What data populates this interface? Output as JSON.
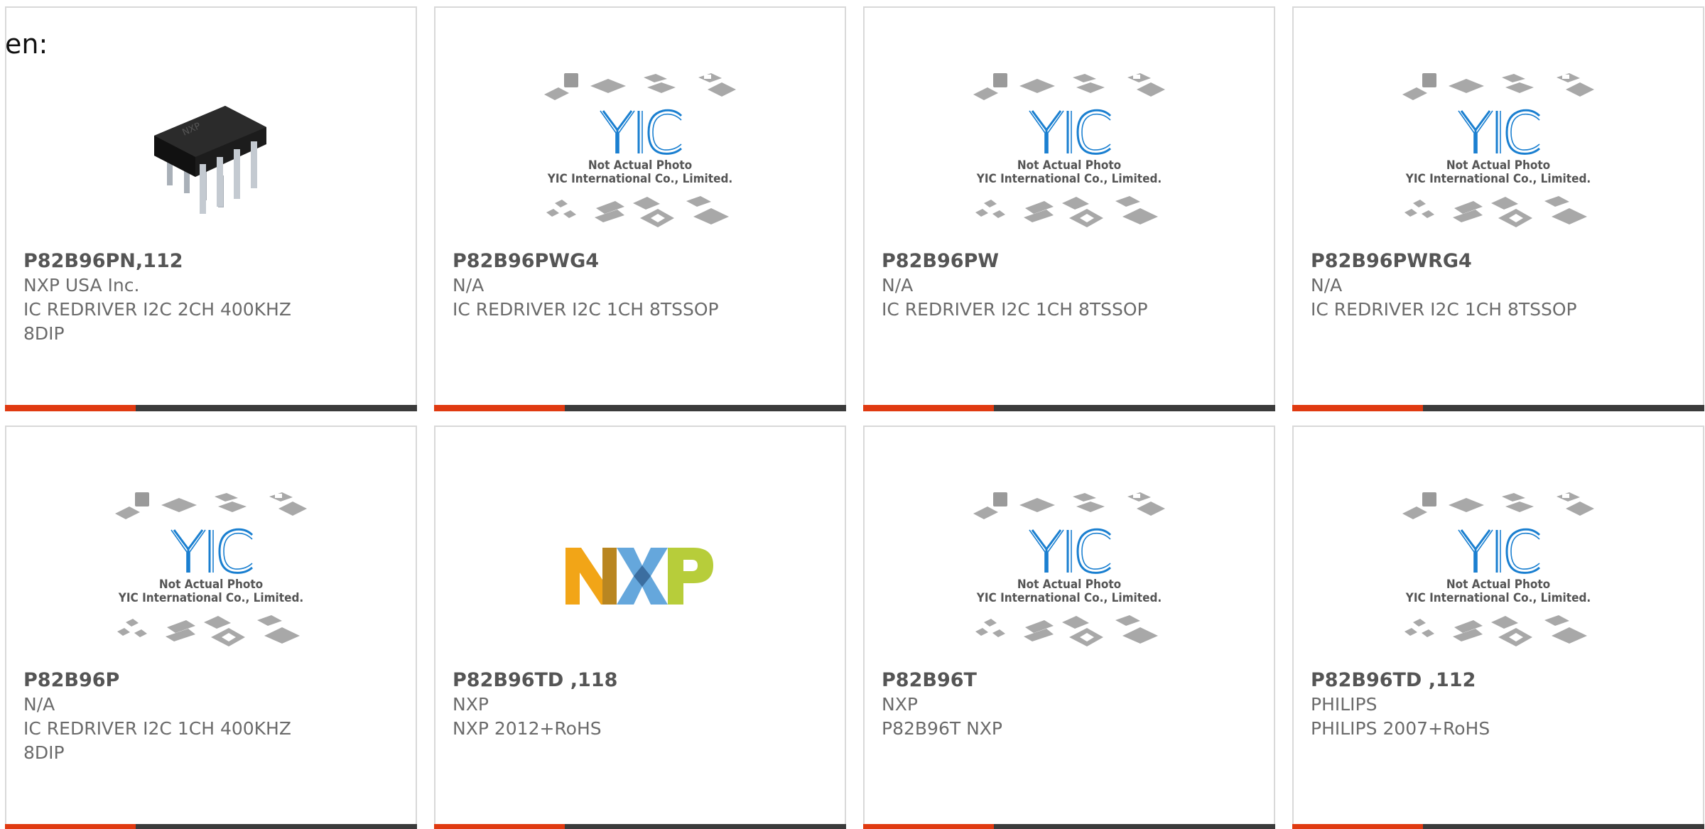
{
  "fragment_text": "en:",
  "placeholder_caption": {
    "line1": "Not Actual Photo",
    "line2": "YIC International Co., Limited."
  },
  "colors": {
    "accent": "#e03a11",
    "bar": "#3b3b3b",
    "yic_blue": "#1a7fd0"
  },
  "products": [
    {
      "part": "P82B96PN,112",
      "maker": "NXP USA Inc.",
      "desc": "IC REDRIVER I2C 2CH 400KHZ 8DIP",
      "image": "dip8-chip-photo"
    },
    {
      "part": "P82B96PWG4",
      "maker": "N/A",
      "desc": "IC REDRIVER I2C 1CH 8TSSOP",
      "image": "yic-placeholder"
    },
    {
      "part": "P82B96PW",
      "maker": "N/A",
      "desc": "IC REDRIVER I2C 1CH 8TSSOP",
      "image": "yic-placeholder"
    },
    {
      "part": "P82B96PWRG4",
      "maker": "N/A",
      "desc": "IC REDRIVER I2C 1CH 8TSSOP",
      "image": "yic-placeholder"
    },
    {
      "part": "P82B96P",
      "maker": "N/A",
      "desc": "IC REDRIVER I2C 1CH 400KHZ 8DIP",
      "image": "yic-placeholder"
    },
    {
      "part": "P82B96TD ,118",
      "maker": "NXP",
      "desc": "NXP 2012+RoHS",
      "image": "nxp-logo"
    },
    {
      "part": "P82B96T",
      "maker": "NXP",
      "desc": "P82B96T NXP",
      "image": "yic-placeholder"
    },
    {
      "part": "P82B96TD ,112",
      "maker": "PHILIPS",
      "desc": "PHILIPS 2007+RoHS",
      "image": "yic-placeholder"
    }
  ]
}
